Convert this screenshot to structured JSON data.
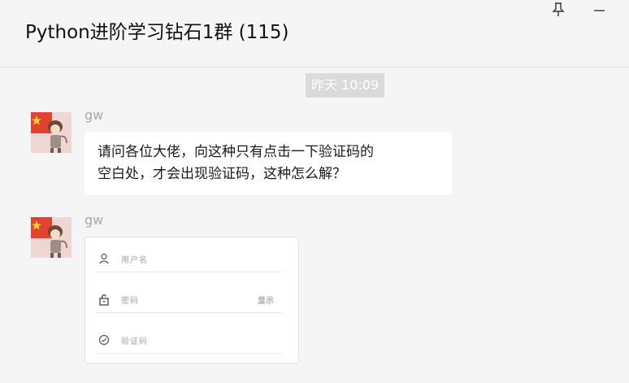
{
  "window": {
    "title": "Python进阶学习钻石1群 (115)",
    "pin_icon": "pin-icon",
    "minimize_icon": "minimize-icon"
  },
  "timestamp": "昨天 10:09",
  "messages": [
    {
      "sender": "gw",
      "avatar": "avatar-icon",
      "text_line1": "请问各位大佬，向这种只有点击一下验证码的",
      "text_line2": "空白处，才会出现验证码，这种怎么解？"
    },
    {
      "sender": "gw",
      "avatar": "avatar-icon",
      "image": {
        "fields": [
          {
            "icon": "user-icon",
            "label": "用户名"
          },
          {
            "icon": "lock-icon",
            "label": "密码",
            "right": "显示"
          },
          {
            "icon": "shield-icon",
            "label": "验证码"
          }
        ]
      }
    }
  ],
  "colors": {
    "background": "#f5f5f5",
    "bubble": "#ffffff",
    "timestamp_bg": "#dadada",
    "sender": "#a8a8a8"
  }
}
